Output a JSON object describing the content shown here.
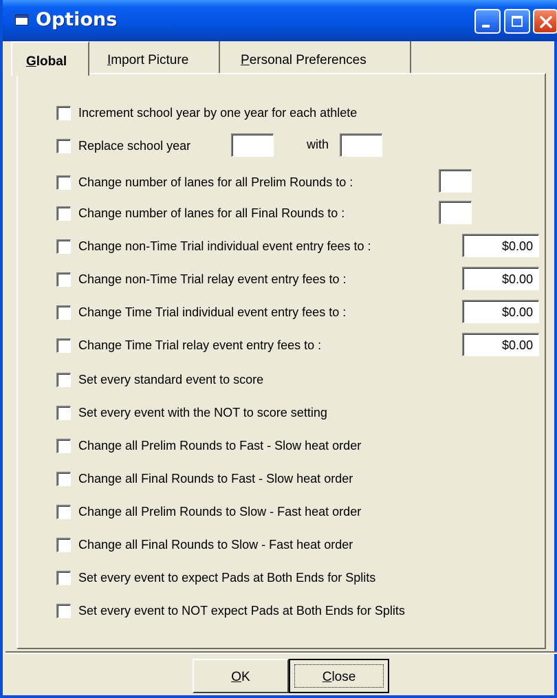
{
  "window": {
    "title": "Options"
  },
  "tabs": [
    {
      "label": "Global",
      "accel": "G",
      "rest": "lobal"
    },
    {
      "label": "Import Picture",
      "accel": "I",
      "rest": "mport Picture"
    },
    {
      "label": "Personal Preferences",
      "accel": "P",
      "rest": "ersonal Preferences"
    }
  ],
  "global": {
    "increment": "Increment school year by one year for each athlete",
    "replace": "Replace school year",
    "replace_with": "with",
    "replace_from_value": "",
    "replace_to_value": "",
    "prelim_lanes": "Change number of lanes for all Prelim Rounds to :",
    "prelim_lanes_value": "",
    "final_lanes": "Change number of lanes for all Final Rounds to :",
    "final_lanes_value": "",
    "fee_ind": "Change non-Time Trial individual event entry fees to :",
    "fee_ind_value": "$0.00",
    "fee_relay": "Change non-Time Trial relay event entry fees to :",
    "fee_relay_value": "$0.00",
    "tt_ind": "Change Time Trial individual event entry fees to :",
    "tt_ind_value": "$0.00",
    "tt_relay": "Change Time Trial relay event entry fees to :",
    "tt_relay_value": "$0.00",
    "score": "Set every standard event to score",
    "not_score": "Set every event with the NOT to score setting",
    "prelim_fast_slow": "Change all Prelim Rounds to Fast - Slow heat order",
    "final_fast_slow": "Change all Final Rounds to Fast - Slow heat order",
    "prelim_slow_fast": "Change all Prelim Rounds to Slow - Fast heat order",
    "final_slow_fast": "Change all Final Rounds to Slow - Fast heat order",
    "pads_both": "Set every event to expect Pads at Both Ends for Splits",
    "pads_not": "Set every event to NOT expect Pads at Both Ends for Splits"
  },
  "buttons": {
    "ok": "OK",
    "ok_accel": "O",
    "ok_rest": "K",
    "close": "Close",
    "close_accel": "C",
    "close_rest": "lose"
  }
}
